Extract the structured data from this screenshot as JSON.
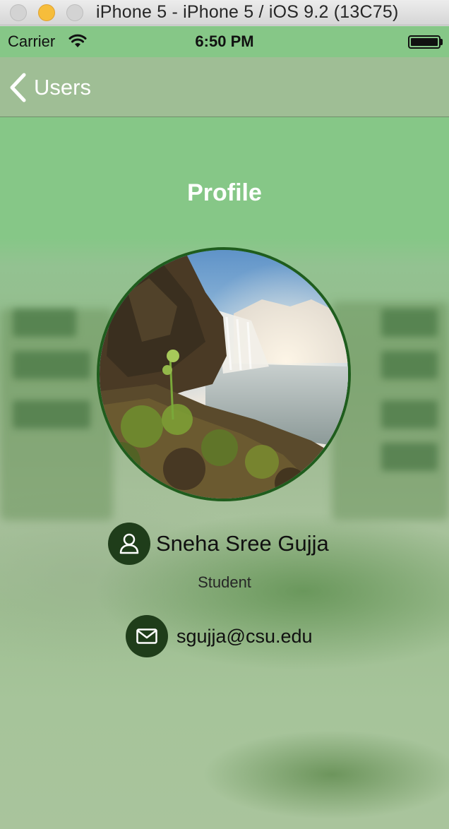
{
  "window": {
    "title": "iPhone 5 - iPhone 5 / iOS 9.2 (13C75)"
  },
  "status_bar": {
    "carrier": "Carrier",
    "time": "6:50 PM"
  },
  "nav": {
    "back_label": "Users"
  },
  "page": {
    "title": "Profile"
  },
  "profile": {
    "name": "Sneha Sree Gujja",
    "role": "Student",
    "email": "sgujja@csu.edu"
  },
  "colors": {
    "accent_dark_green": "#1f3d1a",
    "avatar_border": "#1f5d1d",
    "nav_text": "#ffffff"
  },
  "icons": {
    "back": "chevron-left-icon",
    "user": "person-icon",
    "mail": "envelope-icon",
    "wifi": "wifi-icon",
    "battery": "battery-icon"
  }
}
